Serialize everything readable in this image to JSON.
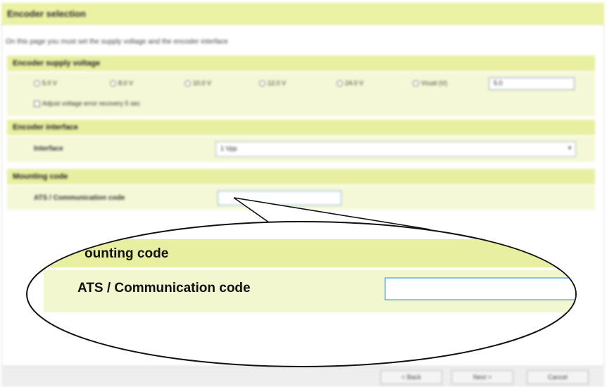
{
  "dialog": {
    "title": "Encoder selection",
    "description": "On this page you must set the supply voltage and the encoder interface"
  },
  "supply_voltage": {
    "heading": "Encoder supply voltage",
    "options": [
      "5.0 V",
      "8.0 V",
      "10.0 V",
      "12.0 V",
      "24.0 V",
      "Vcust (V)"
    ],
    "selected_index": 0,
    "custom_value": "5.0",
    "check_label": "Adjust voltage error recovery 5 sec"
  },
  "encoder_interface": {
    "heading": "Encoder interface",
    "label": "Interface",
    "value": "1 Vpp"
  },
  "mounting_code": {
    "heading": "Mounting code",
    "label": "ATS / Communication code",
    "value": ""
  },
  "zoom": {
    "heading": "ounting code",
    "label": "ATS / Communication code"
  },
  "footer": {
    "back": "< Back",
    "next": "Next >",
    "cancel": "Cancel"
  },
  "colors": {
    "section_heading_bg": "#e8efa0",
    "section_body_bg": "#f5f8d6",
    "input_border_focus": "#4e9ed9"
  }
}
